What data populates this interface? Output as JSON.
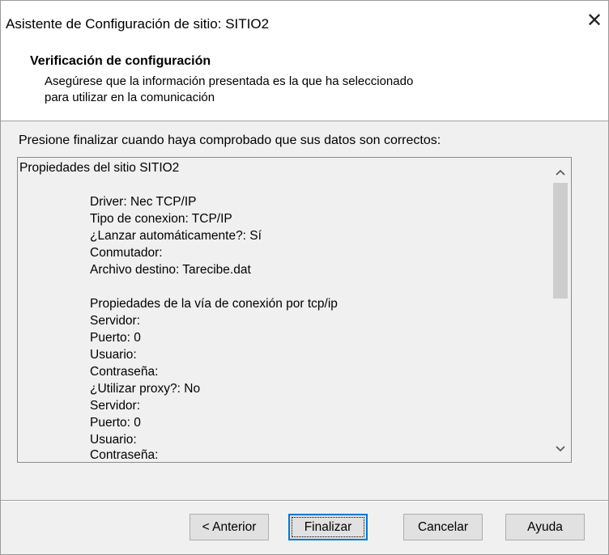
{
  "window": {
    "title": "Asistente de Configuración de sitio: SITIO2",
    "close_glyph": "✕"
  },
  "header": {
    "title": "Verificación de configuración",
    "description_line1": "Asegúrese que la información presentada es la que ha seleccionado",
    "description_line2": "para utilizar en la comunicación"
  },
  "instruction": "Presione finalizar cuando haya comprobado que sus datos son correctos:",
  "properties": {
    "heading": "Propiedades del sitio SITIO2",
    "lines": [
      "Driver: Nec TCP/IP",
      "Tipo de conexion: TCP/IP",
      "¿Lanzar automáticamente?: Sí",
      "Conmutador:",
      "Archivo destino: Tarecibe.dat",
      "",
      "Propiedades de la vía de conexión por tcp/ip",
      "Servidor:",
      "Puerto: 0",
      "Usuario:",
      "Contraseña:",
      "¿Utilizar proxy?: No",
      "Servidor:",
      "Puerto: 0",
      "Usuario:",
      "Contraseña:"
    ]
  },
  "scrollbar": {
    "up_glyph": "⌃",
    "down_glyph": "⌄"
  },
  "buttons": {
    "back": "< Anterior",
    "finish": "Finalizar",
    "cancel": "Cancelar",
    "help": "Ayuda"
  }
}
